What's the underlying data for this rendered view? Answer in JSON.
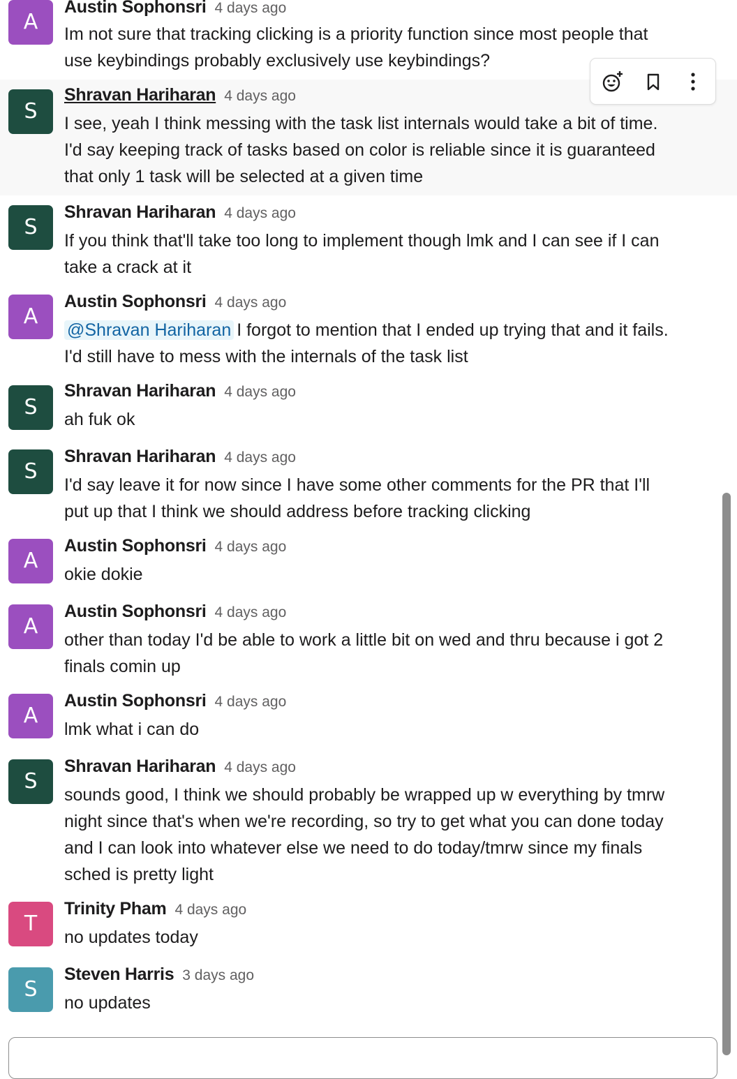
{
  "colors": {
    "austin": "#9b4fbf",
    "shravan": "#1e4d40",
    "trinity": "#d94a80",
    "steven": "#4a9bad",
    "mention_bg": "#e8f5fa",
    "mention_fg": "#1264a3"
  },
  "toolbar_icons": [
    "add-reaction-icon",
    "bookmark-icon",
    "more-actions-icon"
  ],
  "messages": [
    {
      "initial": "A",
      "author": "Austin Sophonsri",
      "time": "4 days ago",
      "lines": [
        "Im not sure that tracking clicking is a priority function since most people that",
        "use keybindings probably exclusively use keybindings?"
      ]
    },
    {
      "initial": "S",
      "author": "Shravan Hariharan",
      "time": "4 days ago",
      "lines": [
        "I see, yeah I think messing with the task list internals would take a bit of time.",
        "I'd say keeping track of tasks based on color is reliable since it is guaranteed",
        "that only 1 task will be selected at a given time"
      ]
    },
    {
      "initial": "S",
      "author": "Shravan Hariharan",
      "time": "4 days ago",
      "lines": [
        "If you think that'll take too long to implement though lmk and I can see if I can",
        "take a crack at it"
      ]
    },
    {
      "initial": "A",
      "author": "Austin Sophonsri",
      "time": "4 days ago",
      "mention": "@Shravan Hariharan",
      "lines": [
        "I forgot to mention that I ended up trying that and it fails.",
        "I'd still have to mess with the internals of the task list"
      ]
    },
    {
      "initial": "S",
      "author": "Shravan Hariharan",
      "time": "4 days ago",
      "lines": [
        "ah fuk ok"
      ]
    },
    {
      "initial": "S",
      "author": "Shravan Hariharan",
      "time": "4 days ago",
      "lines": [
        "I'd say leave it for now since I have some other comments for the PR that I'll",
        "put up that I think we should address before tracking clicking"
      ]
    },
    {
      "initial": "A",
      "author": "Austin Sophonsri",
      "time": "4 days ago",
      "lines": [
        "okie dokie"
      ]
    },
    {
      "initial": "A",
      "author": "Austin Sophonsri",
      "time": "4 days ago",
      "lines": [
        "other than today I'd be able to work a little bit on wed and thru because i got 2",
        "finals comin up"
      ]
    },
    {
      "initial": "A",
      "author": "Austin Sophonsri",
      "time": "4 days ago",
      "lines": [
        "lmk what i can do"
      ]
    },
    {
      "initial": "S",
      "author": "Shravan Hariharan",
      "time": "4 days ago",
      "lines": [
        "sounds good, I think we should probably be wrapped up w everything by tmrw",
        "night since that's when we're recording, so try to get what you can done today",
        "and I can look into whatever else we need to do today/tmrw since my finals",
        "sched is pretty light"
      ]
    },
    {
      "initial": "T",
      "author": "Trinity Pham",
      "time": "4 days ago",
      "lines": [
        "no updates today"
      ]
    },
    {
      "initial": "S",
      "author": "Steven Harris",
      "time": "3 days ago",
      "lines": [
        "no updates"
      ]
    }
  ]
}
